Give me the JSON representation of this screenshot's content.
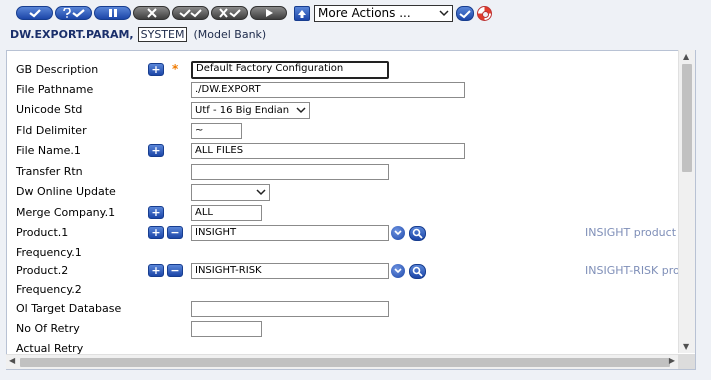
{
  "toolbar": {
    "buttons": [
      {
        "name": "commit-button",
        "icon": "check-icon"
      },
      {
        "name": "validate-button",
        "icon": "question-check-icon"
      },
      {
        "name": "hold-button",
        "icon": "pause-icon"
      },
      {
        "name": "delete-button",
        "icon": "x-icon"
      },
      {
        "name": "authorise-button",
        "icon": "double-check-icon"
      },
      {
        "name": "reverse-button",
        "icon": "x-check-icon"
      },
      {
        "name": "next-button",
        "icon": "play-icon"
      }
    ],
    "more_actions": "More Actions ...",
    "colors": {
      "blue": "#1c46a8",
      "gray": "#3e3e3e"
    }
  },
  "breadcrumb": {
    "application": "DW.EXPORT.PARAM,",
    "company": "SYSTEM",
    "bank": "(Model Bank)"
  },
  "form": {
    "gb_description": {
      "label": "GB Description",
      "value": "Default Factory Configuration"
    },
    "file_pathname": {
      "label": "File Pathname",
      "value": "./DW.EXPORT"
    },
    "unicode_std": {
      "label": "Unicode Std",
      "value": "Utf - 16 Big Endian"
    },
    "fld_delimiter": {
      "label": "Fld Delimiter",
      "value": "~"
    },
    "file_name_1": {
      "label": "File Name.1",
      "value": "ALL FILES"
    },
    "transfer_rtn": {
      "label": "Transfer Rtn",
      "value": ""
    },
    "dw_online_update": {
      "label": "Dw Online Update",
      "value": ""
    },
    "merge_company_1": {
      "label": "Merge Company.1",
      "value": "ALL"
    },
    "product_1": {
      "label": "Product.1",
      "value": "INSIGHT",
      "enrichment": "INSIGHT product"
    },
    "frequency_1": {
      "label": "Frequency.1"
    },
    "product_2": {
      "label": "Product.2",
      "value": "INSIGHT-RISK",
      "enrichment": "INSIGHT-RISK prod"
    },
    "frequency_2": {
      "label": "Frequency.2"
    },
    "ol_target_database": {
      "label": "Ol Target Database",
      "value": ""
    },
    "no_of_retry": {
      "label": "No Of Retry",
      "value": ""
    },
    "actual_retry": {
      "label": "Actual Retry"
    }
  },
  "glyphs": {
    "plus": "+",
    "minus": "−",
    "required": "*",
    "dropdown": "⌄"
  }
}
